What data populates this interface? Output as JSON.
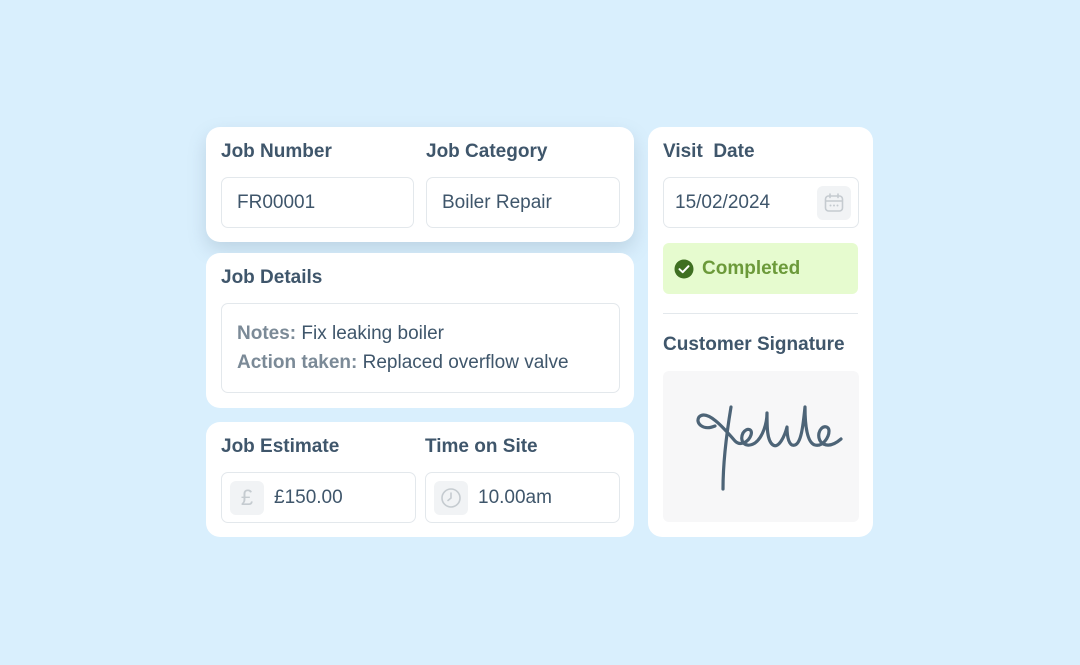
{
  "job": {
    "number_label": "Job Number",
    "number_value": "FR00001",
    "category_label": "Job Category",
    "category_value": "Boiler Repair"
  },
  "details": {
    "title": "Job Details",
    "notes_label": "Notes:",
    "notes_value": " Fix leaking boiler",
    "action_label": "Action taken:",
    "action_value": " Replaced overflow valve"
  },
  "estimate": {
    "label": "Job Estimate",
    "currency_icon": "pound-icon",
    "value": "£150.00"
  },
  "time": {
    "label": "Time on Site",
    "icon": "clock-icon",
    "value": "10.00am"
  },
  "visit": {
    "label": "Visit  Date",
    "value": "15/02/2024",
    "icon": "calendar-icon"
  },
  "status": {
    "text": "Completed",
    "icon": "check-circle-icon",
    "bg_color": "#e6fbcf",
    "text_color": "#6c9a3a"
  },
  "signature": {
    "label": "Customer Signature"
  },
  "colors": {
    "background": "#d9effd",
    "card": "#ffffff",
    "text": "#3f566b"
  }
}
